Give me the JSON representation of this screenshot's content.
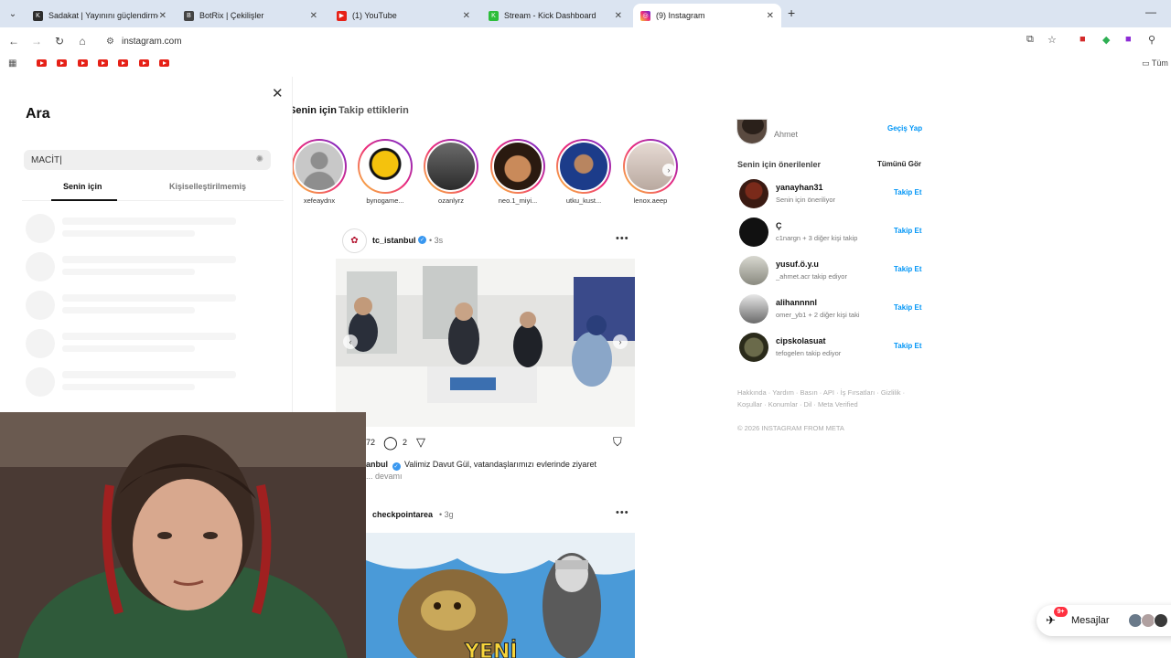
{
  "browser": {
    "tabs": [
      {
        "label": "Sadakat | Yayınını güçlendirme",
        "icon": "kick-icon",
        "active": false
      },
      {
        "label": "BotRix | Çekilişler",
        "icon": "botrix-icon",
        "active": false
      },
      {
        "label": "(1) YouTube",
        "icon": "youtube-icon",
        "active": false
      },
      {
        "label": "Stream - Kick Dashboard",
        "icon": "kick-icon",
        "active": false
      },
      {
        "label": "(9) Instagram",
        "icon": "instagram-icon",
        "active": true
      }
    ],
    "url": "instagram.com",
    "bookmarks_folder": "Tüm"
  },
  "search_panel": {
    "title": "Ara",
    "query": "MACİT",
    "tabs": [
      "Senin için",
      "Kişiselleştirilmemiş"
    ],
    "active_tab": "Senin için"
  },
  "feed": {
    "tabs": [
      "Senin için",
      "Takip ettiklerin"
    ],
    "active_tab": "Senin için",
    "stories": [
      {
        "name": "xefeaydnx",
        "color": "#c8c8c8"
      },
      {
        "name": "bynogame...",
        "color": "#f4c20d"
      },
      {
        "name": "ozanlyrz",
        "color": "#3a3a3a"
      },
      {
        "name": "neo.1_miyi...",
        "color": "#a35a2a"
      },
      {
        "name": "utku_kust...",
        "color": "#1c3c8a"
      },
      {
        "name": "lenox.aeep",
        "color": "#d8c9c2"
      }
    ],
    "post1": {
      "user": "tc_istanbul",
      "verified": true,
      "time": "3s",
      "likes_partial": "72",
      "comments": "2",
      "caption_user": "anbul",
      "caption_text": "Valimiz Davut Gül, vatandaşlarımızı evlerinde ziyaret",
      "caption_more": "... devamı"
    },
    "post2": {
      "user": "checkpointarea",
      "time": "3g",
      "image_text": "YENİ"
    }
  },
  "sidebar": {
    "me": {
      "name": "Ahmet",
      "switch": "Geçiş Yap"
    },
    "suggestions_title": "Senin için önerilenler",
    "see_all": "Tümünü Gör",
    "follow_label": "Takip Et",
    "suggestions": [
      {
        "name": "yanayhan31",
        "sub": "Senin için öneriliyor"
      },
      {
        "name": "Ç",
        "sub": "c1nargn + 3 diğer kişi takip"
      },
      {
        "name": "yusuf.ö.y.u",
        "sub": "_ahmet.acr takip ediyor"
      },
      {
        "name": "alihannnnl",
        "sub": "omer_yb1 + 2 diğer kişi taki"
      },
      {
        "name": "cipskolasuat",
        "sub": "tefogelen takip ediyor"
      }
    ],
    "footer_links": "Hakkında · Yardım · Basın · API · İş Fırsatları · Gizlilik · Koşullar · Konumlar · Dil · Meta Verified",
    "copyright": "© 2026 INSTAGRAM FROM META"
  },
  "messages": {
    "label": "Mesajlar",
    "badge": "9+"
  },
  "colors": {
    "accent": "#0095f6",
    "badge": "#ff3040",
    "tabbar": "#dbe4f1"
  }
}
